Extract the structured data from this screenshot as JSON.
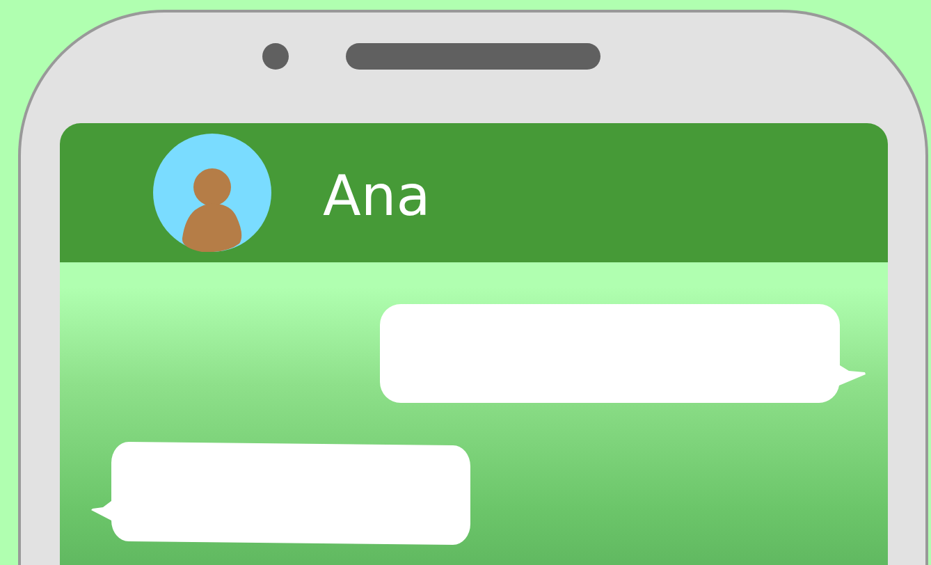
{
  "contact": {
    "name": "Ana"
  },
  "messages": [
    {
      "kind": "outgoing"
    },
    {
      "kind": "incoming"
    }
  ]
}
